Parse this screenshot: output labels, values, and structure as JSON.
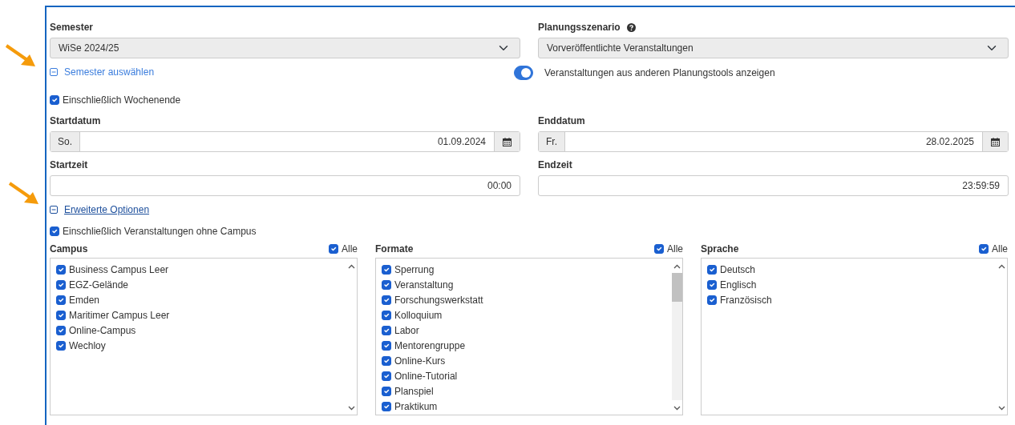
{
  "semester": {
    "label": "Semester",
    "value": "WiSe 2024/25"
  },
  "scenario": {
    "label": "Planungsszenario",
    "value": "Vorveröffentlichte Veranstaltungen"
  },
  "semester_toggle": {
    "label": "Semester auswählen",
    "expanded": true
  },
  "other_tools_switch": {
    "label": "Veranstaltungen aus anderen Planungstools anzeigen",
    "on": true
  },
  "include_weekend": {
    "label": "Einschließlich Wochenende",
    "checked": true
  },
  "start_date": {
    "label": "Startdatum",
    "weekday": "So.",
    "value": "01.09.2024"
  },
  "end_date": {
    "label": "Enddatum",
    "weekday": "Fr.",
    "value": "28.02.2025"
  },
  "start_time": {
    "label": "Startzeit",
    "value": "00:00"
  },
  "end_time": {
    "label": "Endzeit",
    "value": "23:59:59"
  },
  "advanced_toggle": {
    "label": "Erweiterte Optionen",
    "expanded": true
  },
  "include_no_campus": {
    "label": "Einschließlich Veranstaltungen ohne Campus",
    "checked": true
  },
  "filters": [
    {
      "title": "Campus",
      "all_label": "Alle",
      "all_checked": true,
      "items": [
        {
          "label": "Business Campus Leer",
          "checked": true
        },
        {
          "label": "EGZ-Gelände",
          "checked": true
        },
        {
          "label": "Emden",
          "checked": true
        },
        {
          "label": "Maritimer Campus Leer",
          "checked": true
        },
        {
          "label": "Online-Campus",
          "checked": true
        },
        {
          "label": "Wechloy",
          "checked": true
        }
      ]
    },
    {
      "title": "Formate",
      "all_label": "Alle",
      "all_checked": true,
      "items": [
        {
          "label": "Sperrung",
          "checked": true
        },
        {
          "label": "Veranstaltung",
          "checked": true
        },
        {
          "label": "Forschungswerkstatt",
          "checked": true
        },
        {
          "label": "Kolloquium",
          "checked": true
        },
        {
          "label": "Labor",
          "checked": true
        },
        {
          "label": "Mentorengruppe",
          "checked": true
        },
        {
          "label": "Online-Kurs",
          "checked": true
        },
        {
          "label": "Online-Tutorial",
          "checked": true
        },
        {
          "label": "Planspiel",
          "checked": true
        },
        {
          "label": "Praktikum",
          "checked": true
        }
      ]
    },
    {
      "title": "Sprache",
      "all_label": "Alle",
      "all_checked": true,
      "items": [
        {
          "label": "Deutsch",
          "checked": true
        },
        {
          "label": "Englisch",
          "checked": true
        },
        {
          "label": "Französisch",
          "checked": true
        }
      ]
    }
  ]
}
